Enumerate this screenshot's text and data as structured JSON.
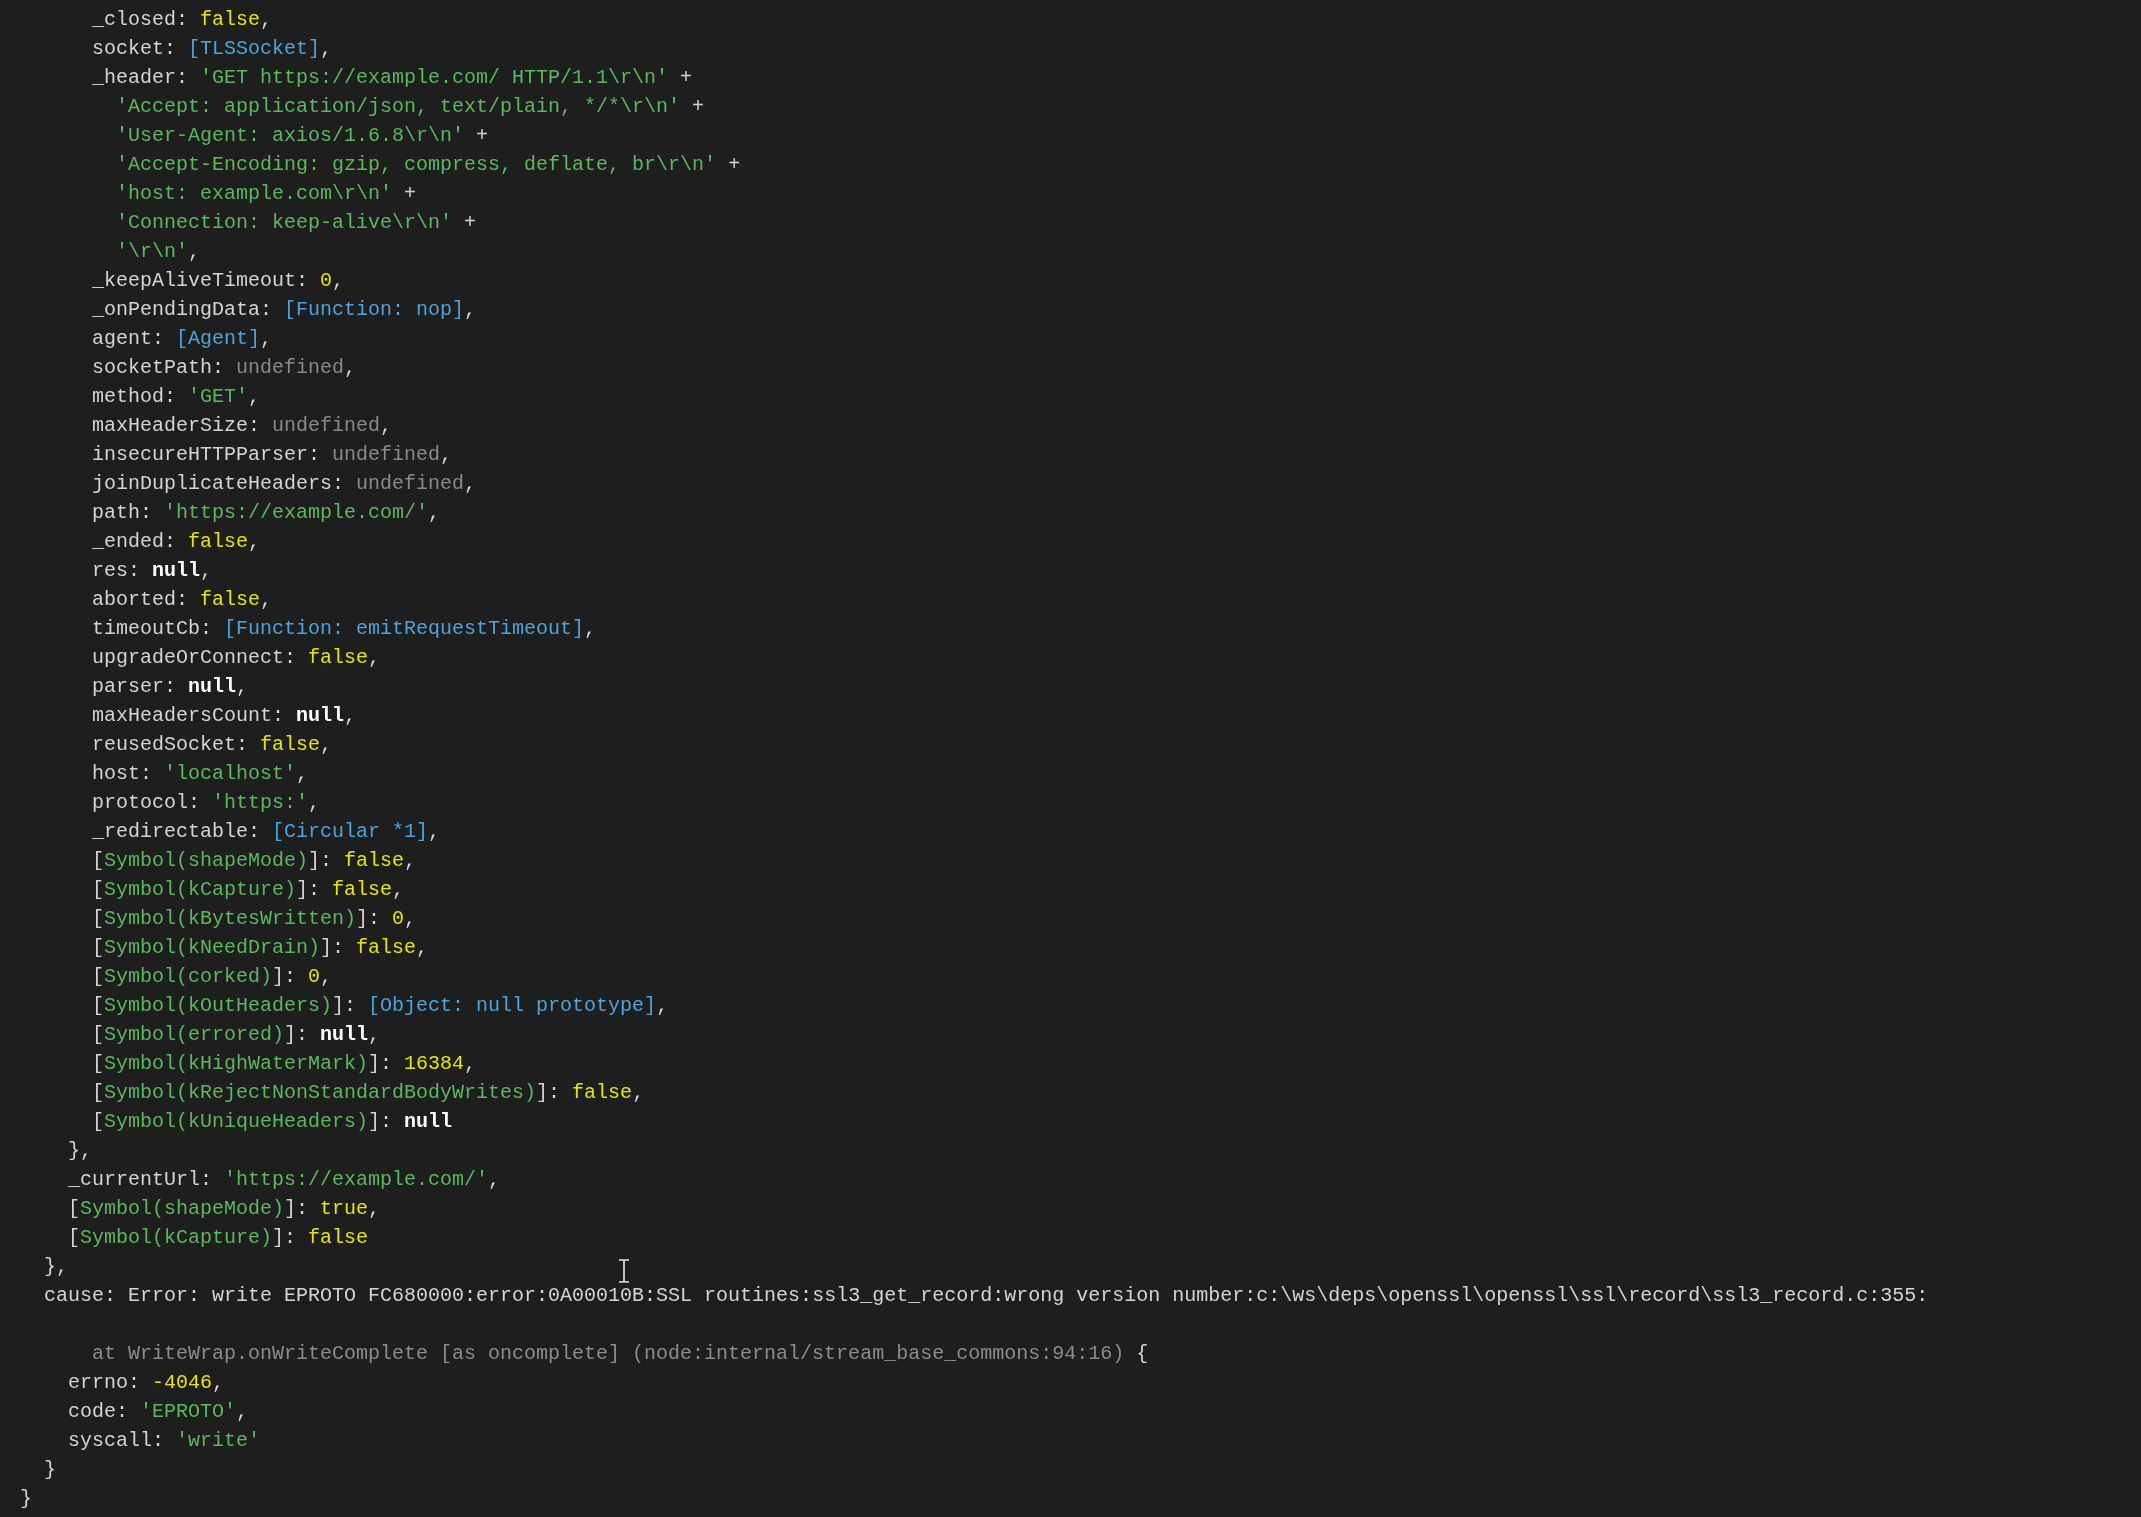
{
  "terminal": {
    "lines": [
      {
        "kind": "block",
        "children": [
          {
            "kind": "block",
            "children": [
              {
                "kind": "block",
                "children": [
                  {
                    "kind": "code",
                    "tokens": [
                      {
                        "kind": "plain",
                        "text": "_closed: "
                      },
                      {
                        "kind": "boolean",
                        "text": "false"
                      },
                      {
                        "kind": "plain",
                        "text": ","
                      }
                    ]
                  },
                  {
                    "kind": "code",
                    "tokens": [
                      {
                        "kind": "plain",
                        "text": "socket: "
                      },
                      {
                        "kind": "special",
                        "text": "[TLSSocket]"
                      },
                      {
                        "kind": "plain",
                        "text": ","
                      }
                    ]
                  },
                  {
                    "kind": "code",
                    "tokens": [
                      {
                        "kind": "plain",
                        "text": "_header: "
                      },
                      {
                        "kind": "string",
                        "text": "'GET https://example.com/ HTTP/1.1\\r\\n'"
                      },
                      {
                        "kind": "plain",
                        "text": " +"
                      }
                    ]
                  },
                  {
                    "kind": "block",
                    "children": [
                      {
                        "kind": "code",
                        "tokens": [
                          {
                            "kind": "string",
                            "text": "'Accept: application/json, text/plain, */*\\r\\n'"
                          },
                          {
                            "kind": "plain",
                            "text": " +"
                          }
                        ]
                      },
                      {
                        "kind": "code",
                        "tokens": [
                          {
                            "kind": "string",
                            "text": "'User-Agent: axios/1.6.8\\r\\n'"
                          },
                          {
                            "kind": "plain",
                            "text": " +"
                          }
                        ]
                      },
                      {
                        "kind": "code",
                        "tokens": [
                          {
                            "kind": "string",
                            "text": "'Accept-Encoding: gzip, compress, deflate, br\\r\\n'"
                          },
                          {
                            "kind": "plain",
                            "text": " +"
                          }
                        ]
                      },
                      {
                        "kind": "code",
                        "tokens": [
                          {
                            "kind": "string",
                            "text": "'host: example.com\\r\\n'"
                          },
                          {
                            "kind": "plain",
                            "text": " +"
                          }
                        ]
                      },
                      {
                        "kind": "code",
                        "tokens": [
                          {
                            "kind": "string",
                            "text": "'Connection: keep-alive\\r\\n'"
                          },
                          {
                            "kind": "plain",
                            "text": " +"
                          }
                        ]
                      },
                      {
                        "kind": "code",
                        "tokens": [
                          {
                            "kind": "string",
                            "text": "'\\r\\n'"
                          },
                          {
                            "kind": "plain",
                            "text": ","
                          }
                        ]
                      }
                    ]
                  },
                  {
                    "kind": "code",
                    "tokens": [
                      {
                        "kind": "plain",
                        "text": "_keepAliveTimeout: "
                      },
                      {
                        "kind": "number",
                        "text": "0"
                      },
                      {
                        "kind": "plain",
                        "text": ","
                      }
                    ]
                  },
                  {
                    "kind": "code",
                    "tokens": [
                      {
                        "kind": "plain",
                        "text": "_onPendingData: "
                      },
                      {
                        "kind": "special",
                        "text": "[Function: nop]"
                      },
                      {
                        "kind": "plain",
                        "text": ","
                      }
                    ]
                  },
                  {
                    "kind": "code",
                    "tokens": [
                      {
                        "kind": "plain",
                        "text": "agent: "
                      },
                      {
                        "kind": "special",
                        "text": "[Agent]"
                      },
                      {
                        "kind": "plain",
                        "text": ","
                      }
                    ]
                  },
                  {
                    "kind": "code",
                    "tokens": [
                      {
                        "kind": "plain",
                        "text": "socketPath: "
                      },
                      {
                        "kind": "undefined",
                        "text": "undefined"
                      },
                      {
                        "kind": "plain",
                        "text": ","
                      }
                    ]
                  },
                  {
                    "kind": "code",
                    "tokens": [
                      {
                        "kind": "plain",
                        "text": "method: "
                      },
                      {
                        "kind": "string",
                        "text": "'GET'"
                      },
                      {
                        "kind": "plain",
                        "text": ","
                      }
                    ]
                  },
                  {
                    "kind": "code",
                    "tokens": [
                      {
                        "kind": "plain",
                        "text": "maxHeaderSize: "
                      },
                      {
                        "kind": "undefined",
                        "text": "undefined"
                      },
                      {
                        "kind": "plain",
                        "text": ","
                      }
                    ]
                  },
                  {
                    "kind": "code",
                    "tokens": [
                      {
                        "kind": "plain",
                        "text": "insecureHTTPParser: "
                      },
                      {
                        "kind": "undefined",
                        "text": "undefined"
                      },
                      {
                        "kind": "plain",
                        "text": ","
                      }
                    ]
                  },
                  {
                    "kind": "code",
                    "tokens": [
                      {
                        "kind": "plain",
                        "text": "joinDuplicateHeaders: "
                      },
                      {
                        "kind": "undefined",
                        "text": "undefined"
                      },
                      {
                        "kind": "plain",
                        "text": ","
                      }
                    ]
                  },
                  {
                    "kind": "code",
                    "tokens": [
                      {
                        "kind": "plain",
                        "text": "path: "
                      },
                      {
                        "kind": "string",
                        "text": "'https://example.com/'"
                      },
                      {
                        "kind": "plain",
                        "text": ","
                      }
                    ]
                  },
                  {
                    "kind": "code",
                    "tokens": [
                      {
                        "kind": "plain",
                        "text": "_ended: "
                      },
                      {
                        "kind": "boolean",
                        "text": "false"
                      },
                      {
                        "kind": "plain",
                        "text": ","
                      }
                    ]
                  },
                  {
                    "kind": "code",
                    "tokens": [
                      {
                        "kind": "plain",
                        "text": "res: "
                      },
                      {
                        "kind": "null",
                        "text": "null"
                      },
                      {
                        "kind": "plain",
                        "text": ","
                      }
                    ]
                  },
                  {
                    "kind": "code",
                    "tokens": [
                      {
                        "kind": "plain",
                        "text": "aborted: "
                      },
                      {
                        "kind": "boolean",
                        "text": "false"
                      },
                      {
                        "kind": "plain",
                        "text": ","
                      }
                    ]
                  },
                  {
                    "kind": "code",
                    "tokens": [
                      {
                        "kind": "plain",
                        "text": "timeoutCb: "
                      },
                      {
                        "kind": "special",
                        "text": "[Function: emitRequestTimeout]"
                      },
                      {
                        "kind": "plain",
                        "text": ","
                      }
                    ]
                  },
                  {
                    "kind": "code",
                    "tokens": [
                      {
                        "kind": "plain",
                        "text": "upgradeOrConnect: "
                      },
                      {
                        "kind": "boolean",
                        "text": "false"
                      },
                      {
                        "kind": "plain",
                        "text": ","
                      }
                    ]
                  },
                  {
                    "kind": "code",
                    "tokens": [
                      {
                        "kind": "plain",
                        "text": "parser: "
                      },
                      {
                        "kind": "null",
                        "text": "null"
                      },
                      {
                        "kind": "plain",
                        "text": ","
                      }
                    ]
                  },
                  {
                    "kind": "code",
                    "tokens": [
                      {
                        "kind": "plain",
                        "text": "maxHeadersCount: "
                      },
                      {
                        "kind": "null",
                        "text": "null"
                      },
                      {
                        "kind": "plain",
                        "text": ","
                      }
                    ]
                  },
                  {
                    "kind": "code",
                    "tokens": [
                      {
                        "kind": "plain",
                        "text": "reusedSocket: "
                      },
                      {
                        "kind": "boolean",
                        "text": "false"
                      },
                      {
                        "kind": "plain",
                        "text": ","
                      }
                    ]
                  },
                  {
                    "kind": "code",
                    "tokens": [
                      {
                        "kind": "plain",
                        "text": "host: "
                      },
                      {
                        "kind": "string",
                        "text": "'localhost'"
                      },
                      {
                        "kind": "plain",
                        "text": ","
                      }
                    ]
                  },
                  {
                    "kind": "code",
                    "tokens": [
                      {
                        "kind": "plain",
                        "text": "protocol: "
                      },
                      {
                        "kind": "string",
                        "text": "'https:'"
                      },
                      {
                        "kind": "plain",
                        "text": ","
                      }
                    ]
                  },
                  {
                    "kind": "code",
                    "tokens": [
                      {
                        "kind": "plain",
                        "text": "_redirectable: "
                      },
                      {
                        "kind": "special",
                        "text": "[Circular *1]"
                      },
                      {
                        "kind": "plain",
                        "text": ","
                      }
                    ]
                  },
                  {
                    "kind": "code",
                    "tokens": [
                      {
                        "kind": "plain",
                        "text": "["
                      },
                      {
                        "kind": "string",
                        "text": "Symbol(shapeMode)"
                      },
                      {
                        "kind": "plain",
                        "text": "]: "
                      },
                      {
                        "kind": "boolean",
                        "text": "false"
                      },
                      {
                        "kind": "plain",
                        "text": ","
                      }
                    ]
                  },
                  {
                    "kind": "code",
                    "tokens": [
                      {
                        "kind": "plain",
                        "text": "["
                      },
                      {
                        "kind": "string",
                        "text": "Symbol(kCapture)"
                      },
                      {
                        "kind": "plain",
                        "text": "]: "
                      },
                      {
                        "kind": "boolean",
                        "text": "false"
                      },
                      {
                        "kind": "plain",
                        "text": ","
                      }
                    ]
                  },
                  {
                    "kind": "code",
                    "tokens": [
                      {
                        "kind": "plain",
                        "text": "["
                      },
                      {
                        "kind": "string",
                        "text": "Symbol(kBytesWritten)"
                      },
                      {
                        "kind": "plain",
                        "text": "]: "
                      },
                      {
                        "kind": "number",
                        "text": "0"
                      },
                      {
                        "kind": "plain",
                        "text": ","
                      }
                    ]
                  },
                  {
                    "kind": "code",
                    "tokens": [
                      {
                        "kind": "plain",
                        "text": "["
                      },
                      {
                        "kind": "string",
                        "text": "Symbol(kNeedDrain)"
                      },
                      {
                        "kind": "plain",
                        "text": "]: "
                      },
                      {
                        "kind": "boolean",
                        "text": "false"
                      },
                      {
                        "kind": "plain",
                        "text": ","
                      }
                    ]
                  },
                  {
                    "kind": "code",
                    "tokens": [
                      {
                        "kind": "plain",
                        "text": "["
                      },
                      {
                        "kind": "string",
                        "text": "Symbol(corked)"
                      },
                      {
                        "kind": "plain",
                        "text": "]: "
                      },
                      {
                        "kind": "number",
                        "text": "0"
                      },
                      {
                        "kind": "plain",
                        "text": ","
                      }
                    ]
                  },
                  {
                    "kind": "code",
                    "tokens": [
                      {
                        "kind": "plain",
                        "text": "["
                      },
                      {
                        "kind": "string",
                        "text": "Symbol(kOutHeaders)"
                      },
                      {
                        "kind": "plain",
                        "text": "]: "
                      },
                      {
                        "kind": "special",
                        "text": "[Object: null prototype]"
                      },
                      {
                        "kind": "plain",
                        "text": ","
                      }
                    ]
                  },
                  {
                    "kind": "code",
                    "tokens": [
                      {
                        "kind": "plain",
                        "text": "["
                      },
                      {
                        "kind": "string",
                        "text": "Symbol(errored)"
                      },
                      {
                        "kind": "plain",
                        "text": "]: "
                      },
                      {
                        "kind": "null",
                        "text": "null"
                      },
                      {
                        "kind": "plain",
                        "text": ","
                      }
                    ]
                  },
                  {
                    "kind": "code",
                    "tokens": [
                      {
                        "kind": "plain",
                        "text": "["
                      },
                      {
                        "kind": "string",
                        "text": "Symbol(kHighWaterMark)"
                      },
                      {
                        "kind": "plain",
                        "text": "]: "
                      },
                      {
                        "kind": "number",
                        "text": "16384"
                      },
                      {
                        "kind": "plain",
                        "text": ","
                      }
                    ]
                  },
                  {
                    "kind": "code",
                    "tokens": [
                      {
                        "kind": "plain",
                        "text": "["
                      },
                      {
                        "kind": "string",
                        "text": "Symbol(kRejectNonStandardBodyWrites)"
                      },
                      {
                        "kind": "plain",
                        "text": "]: "
                      },
                      {
                        "kind": "boolean",
                        "text": "false"
                      },
                      {
                        "kind": "plain",
                        "text": ","
                      }
                    ]
                  },
                  {
                    "kind": "code",
                    "tokens": [
                      {
                        "kind": "plain",
                        "text": "["
                      },
                      {
                        "kind": "string",
                        "text": "Symbol(kUniqueHeaders)"
                      },
                      {
                        "kind": "plain",
                        "text": "]: "
                      },
                      {
                        "kind": "null",
                        "text": "null"
                      }
                    ]
                  }
                ]
              },
              {
                "kind": "code",
                "tokens": [
                  {
                    "kind": "plain",
                    "text": "},"
                  }
                ]
              },
              {
                "kind": "code",
                "tokens": [
                  {
                    "kind": "plain",
                    "text": "_currentUrl: "
                  },
                  {
                    "kind": "string",
                    "text": "'https://example.com/'"
                  },
                  {
                    "kind": "plain",
                    "text": ","
                  }
                ]
              },
              {
                "kind": "code",
                "tokens": [
                  {
                    "kind": "plain",
                    "text": "["
                  },
                  {
                    "kind": "string",
                    "text": "Symbol(shapeMode)"
                  },
                  {
                    "kind": "plain",
                    "text": "]: "
                  },
                  {
                    "kind": "boolean",
                    "text": "true"
                  },
                  {
                    "kind": "plain",
                    "text": ","
                  }
                ]
              },
              {
                "kind": "code",
                "tokens": [
                  {
                    "kind": "plain",
                    "text": "["
                  },
                  {
                    "kind": "string",
                    "text": "Symbol(kCapture)"
                  },
                  {
                    "kind": "plain",
                    "text": "]: "
                  },
                  {
                    "kind": "boolean",
                    "text": "false"
                  }
                ]
              }
            ]
          },
          {
            "kind": "code",
            "tokens": [
              {
                "kind": "plain",
                "text": "},"
              }
            ]
          },
          {
            "kind": "code",
            "tokens": [
              {
                "kind": "plain",
                "text": "cause: Error: write EPROTO FC680000:error:0A00010B:SSL routines:ssl3_get_record:wrong version number:c:\\ws\\deps\\openssl\\openssl\\ssl\\record\\ssl3_record.c:355:"
              }
            ]
          },
          {
            "kind": "blank"
          },
          {
            "kind": "block",
            "children": [
              {
                "kind": "block",
                "children": [
                  {
                    "kind": "code",
                    "tokens": [
                      {
                        "kind": "dim",
                        "text": "at WriteWrap.onWriteComplete [as oncomplete] (node:internal/stream_base_commons:94:16)"
                      },
                      {
                        "kind": "plain",
                        "text": " {"
                      }
                    ]
                  }
                ]
              },
              {
                "kind": "code",
                "tokens": [
                  {
                    "kind": "plain",
                    "text": "errno: "
                  },
                  {
                    "kind": "number",
                    "text": "-4046"
                  },
                  {
                    "kind": "plain",
                    "text": ","
                  }
                ]
              },
              {
                "kind": "code",
                "tokens": [
                  {
                    "kind": "plain",
                    "text": "code: "
                  },
                  {
                    "kind": "string",
                    "text": "'EPROTO'"
                  },
                  {
                    "kind": "plain",
                    "text": ","
                  }
                ]
              },
              {
                "kind": "code",
                "tokens": [
                  {
                    "kind": "plain",
                    "text": "syscall: "
                  },
                  {
                    "kind": "string",
                    "text": "'write'"
                  }
                ]
              }
            ]
          },
          {
            "kind": "code",
            "tokens": [
              {
                "kind": "plain",
                "text": "}"
              }
            ]
          }
        ]
      },
      {
        "kind": "code",
        "tokens": [
          {
            "kind": "plain",
            "text": "}"
          }
        ]
      }
    ]
  }
}
